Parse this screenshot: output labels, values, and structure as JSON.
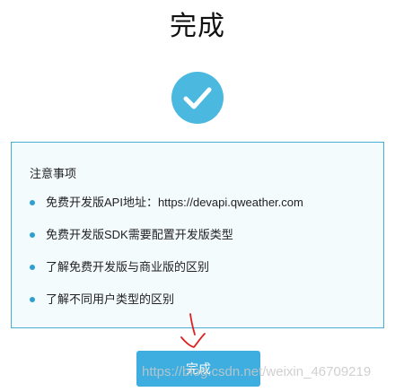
{
  "page": {
    "title": "完成"
  },
  "icons": {
    "success": "check-circle-icon",
    "bullet": "bullet-dot-icon"
  },
  "colors": {
    "accent": "#3eaee0",
    "check_circle": "#4bb9df",
    "notice_border": "#49aed7",
    "notice_background": "#f3fbfd",
    "annotation": "#e02020"
  },
  "notice": {
    "title": "注意事项",
    "items": [
      {
        "text": "免费开发版API地址：https://devapi.qweather.com"
      },
      {
        "text": "免费开发版SDK需要配置开发版类型"
      },
      {
        "text": "了解免费开发版与商业版的区别"
      },
      {
        "text": "了解不同用户类型的区别"
      }
    ]
  },
  "actions": {
    "done_label": "完成"
  },
  "watermark": {
    "text": "https://blog.csdn.net/weixin_46709219"
  }
}
